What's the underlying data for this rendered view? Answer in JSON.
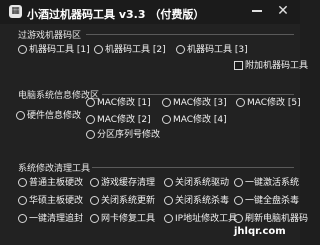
{
  "window": {
    "title": "小酒过机器码工具 v3.3 （付费版）",
    "icon": "app-icon",
    "minimize_icon": "minimize-icon",
    "close_icon": "close-icon",
    "close_glyph": "✕"
  },
  "section1": {
    "title": "过游戏机器码区",
    "radios": [
      {
        "label": "机器码工具 [1]"
      },
      {
        "label": "机器码工具 [2]"
      },
      {
        "label": "机器码工具 [3]"
      }
    ],
    "checkbox": {
      "label": "附加机器码工具",
      "checked": false
    }
  },
  "section2": {
    "title": "电脑系统信息修改区",
    "hardware": {
      "label": "硬件信息修改"
    },
    "mac_items": [
      {
        "label": "MAC修改 [1]"
      },
      {
        "label": "MAC修改 [3]"
      },
      {
        "label": "MAC修改 [5]"
      },
      {
        "label": "MAC修改 [2]"
      },
      {
        "label": "MAC修改 [4]"
      }
    ],
    "partition": {
      "label": "分区序列号修改"
    }
  },
  "section3": {
    "title": "系统修改清理工具",
    "items": [
      {
        "label": "普通主板硬改"
      },
      {
        "label": "游戏缓存清理"
      },
      {
        "label": "关闭系统驱动"
      },
      {
        "label": "一键激活系统"
      },
      {
        "label": "华硕主板硬改"
      },
      {
        "label": "关闭系统更新"
      },
      {
        "label": "关闭系统杀毒"
      },
      {
        "label": "一键全盘杀毒"
      },
      {
        "label": "一键清理追封"
      },
      {
        "label": "网卡修复工具"
      },
      {
        "label": "IP地址修改工具"
      },
      {
        "label": "刷新电脑机器码"
      }
    ]
  },
  "watermark": {
    "text": "jhlqr.com"
  }
}
